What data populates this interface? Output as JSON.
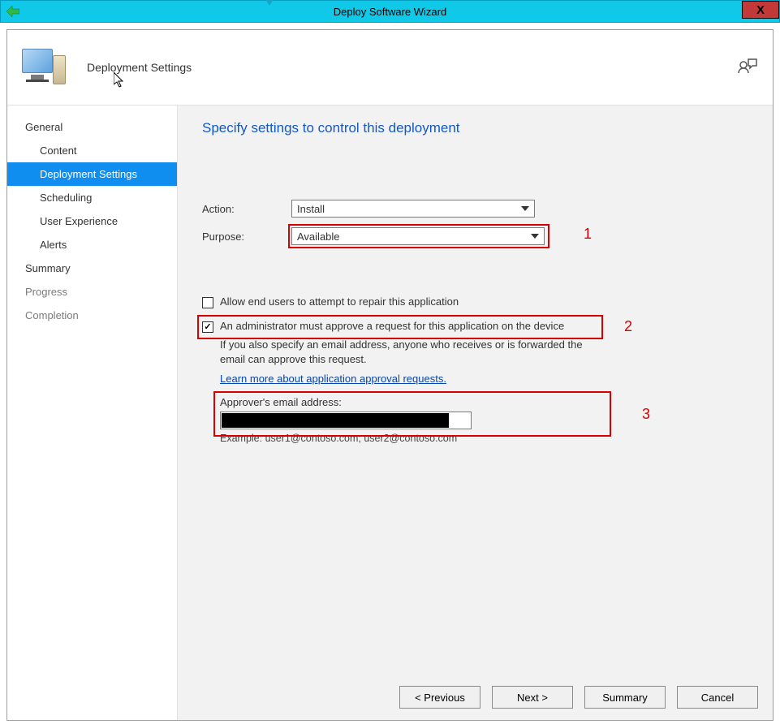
{
  "titlebar": {
    "title": "Deploy Software Wizard",
    "close_label": "X"
  },
  "header": {
    "page_title": "Deployment Settings"
  },
  "sidebar": {
    "items": [
      {
        "label": "General",
        "indent": 0,
        "selected": false,
        "dim": false
      },
      {
        "label": "Content",
        "indent": 1,
        "selected": false,
        "dim": false
      },
      {
        "label": "Deployment Settings",
        "indent": 1,
        "selected": true,
        "dim": false
      },
      {
        "label": "Scheduling",
        "indent": 1,
        "selected": false,
        "dim": false
      },
      {
        "label": "User Experience",
        "indent": 1,
        "selected": false,
        "dim": false
      },
      {
        "label": "Alerts",
        "indent": 1,
        "selected": false,
        "dim": false
      },
      {
        "label": "Summary",
        "indent": 0,
        "selected": false,
        "dim": false
      },
      {
        "label": "Progress",
        "indent": 0,
        "selected": false,
        "dim": true
      },
      {
        "label": "Completion",
        "indent": 0,
        "selected": false,
        "dim": true
      }
    ]
  },
  "main": {
    "heading": "Specify settings to control this deployment",
    "action_label": "Action:",
    "action_value": "Install",
    "purpose_label": "Purpose:",
    "purpose_value": "Available",
    "allow_repair_label": "Allow end users to attempt to repair this application",
    "allow_repair_checked": false,
    "approve_label": "An administrator must approve a request for this application on the device",
    "approve_checked": true,
    "approve_note": "If you also specify an email address, anyone who receives or is forwarded the email can approve this request.",
    "learn_more": "Learn more about application approval requests.",
    "approver_field_label": "Approver's email address:",
    "approver_email_value": "",
    "example_text": "Example: user1@contoso.com; user2@contoso.com"
  },
  "annotations": {
    "n1": "1",
    "n2": "2",
    "n3": "3"
  },
  "footer": {
    "previous": "< Previous",
    "next": "Next >",
    "summary": "Summary",
    "cancel": "Cancel"
  }
}
